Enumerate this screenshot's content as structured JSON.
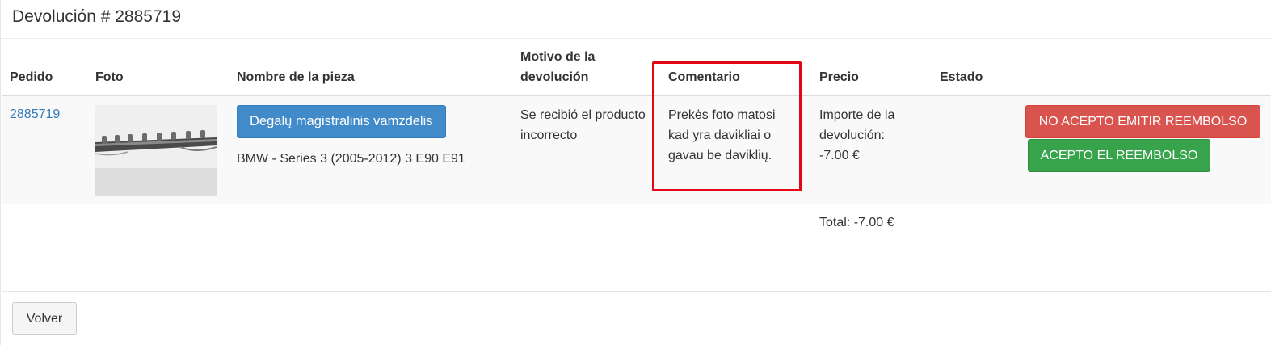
{
  "page": {
    "title": "Devolución # 2885719"
  },
  "table": {
    "headers": {
      "order": "Pedido",
      "photo": "Foto",
      "part_name": "Nombre de la pieza",
      "reason": "Motivo de la devolución",
      "comment": "Comentario",
      "price": "Precio",
      "status": "Estado"
    },
    "row": {
      "order_number": "2885719",
      "photo_icon": "fuel-pipe-photo",
      "part_button_label": "Degalų magistralinis vamzdelis",
      "part_model": "BMW - Series 3 (2005-2012) 3 E90 E91",
      "reason": "Se recibió el producto incorrecto",
      "comment": "Prekės foto matosi kad yra davikliai o gavau be daviklių.",
      "price_label": "Importe de la devolución:",
      "price_value": "-7.00 €",
      "status": ""
    },
    "actions": {
      "reject_label": "NO ACEPTO EMITIR REEMBOLSO",
      "accept_label": "ACEPTO EL REEMBOLSO"
    },
    "total": "Total: -7.00 €"
  },
  "footer": {
    "back_label": "Volver"
  },
  "colors": {
    "link": "#337ab7",
    "primary": "#428bca",
    "danger": "#d9534f",
    "success": "#37a34a",
    "highlight": "#e30613"
  }
}
